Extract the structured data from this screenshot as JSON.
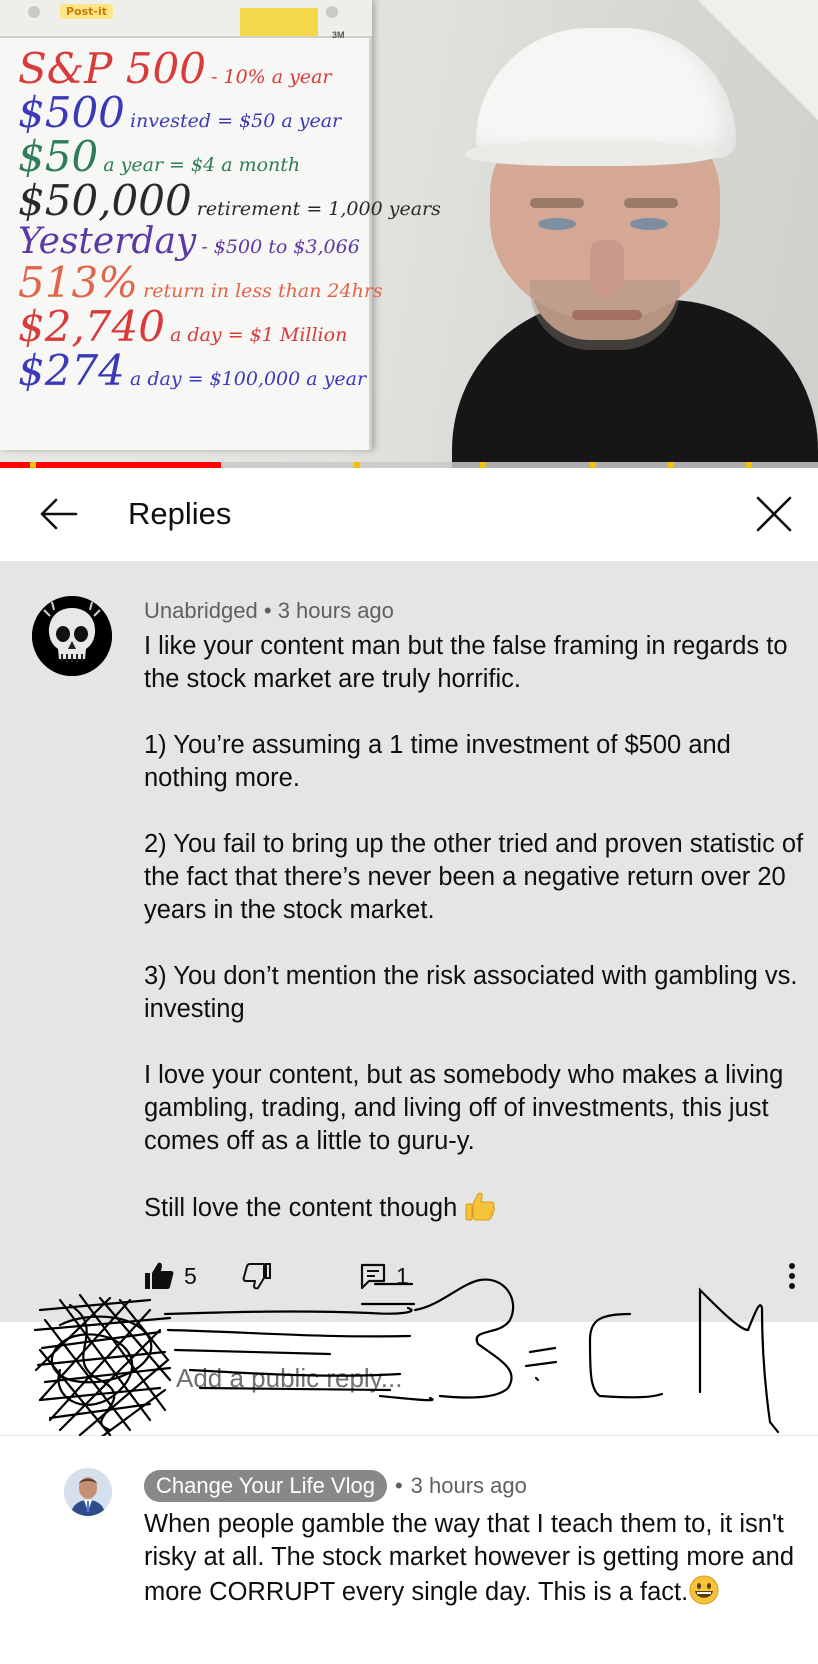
{
  "video": {
    "easel_brand": "Post-it",
    "easel_maker": "3M",
    "board_lines": [
      {
        "big": "S&P 500",
        "small": "- 10% a year"
      },
      {
        "big": "$500",
        "small": "invested = $50 a year"
      },
      {
        "big": "$50",
        "small": "a year = $4 a month"
      },
      {
        "big": "$50,000",
        "small": "retirement = 1,000 years"
      },
      {
        "big": "Yesterday",
        "small": "- $500 to $3,066"
      },
      {
        "big": "513%",
        "small": "return in less than 24hrs"
      },
      {
        "big": "$2,740",
        "small": "a day = $1 Million"
      },
      {
        "big": "$274",
        "small": "a day = $100,000 a year"
      }
    ],
    "progress_played": 0.27
  },
  "header": {
    "title": "Replies",
    "back_icon": "arrow-left-icon",
    "close_icon": "close-icon"
  },
  "comment": {
    "author": "Unabridged",
    "separator": "•",
    "time": "3 hours ago",
    "paragraphs": [
      "I like your content man but the false framing in regards to the stock market are truly horrific.",
      "1) You’re assuming a 1 time investment of $500 and nothing more.",
      "2) You fail to bring up the other tried and proven statistic of the fact that there’s never been a negative return over 20 years in the stock market.",
      "3) You don’t mention the risk associated with gambling vs. investing",
      "I love your content, but as somebody who makes a living gambling, trading, and living off of investments, this just comes off as a little to guru-y.",
      "Still love the content though"
    ],
    "likes": "5",
    "replies": "1"
  },
  "reply_input": {
    "placeholder": "Add a public reply..."
  },
  "reply": {
    "author": "Change Your Life Vlog",
    "separator": "•",
    "time": "3 hours ago",
    "text": "When people gamble the way that I teach them to, it isn't risky at all. The stock market however is getting more and more CORRUPT every single day. This is a fact."
  },
  "colors": {
    "progress_red": "#ff0000",
    "comment_bg": "#e5e5e5",
    "author_chip": "#888888",
    "meta_gray": "#606060"
  }
}
